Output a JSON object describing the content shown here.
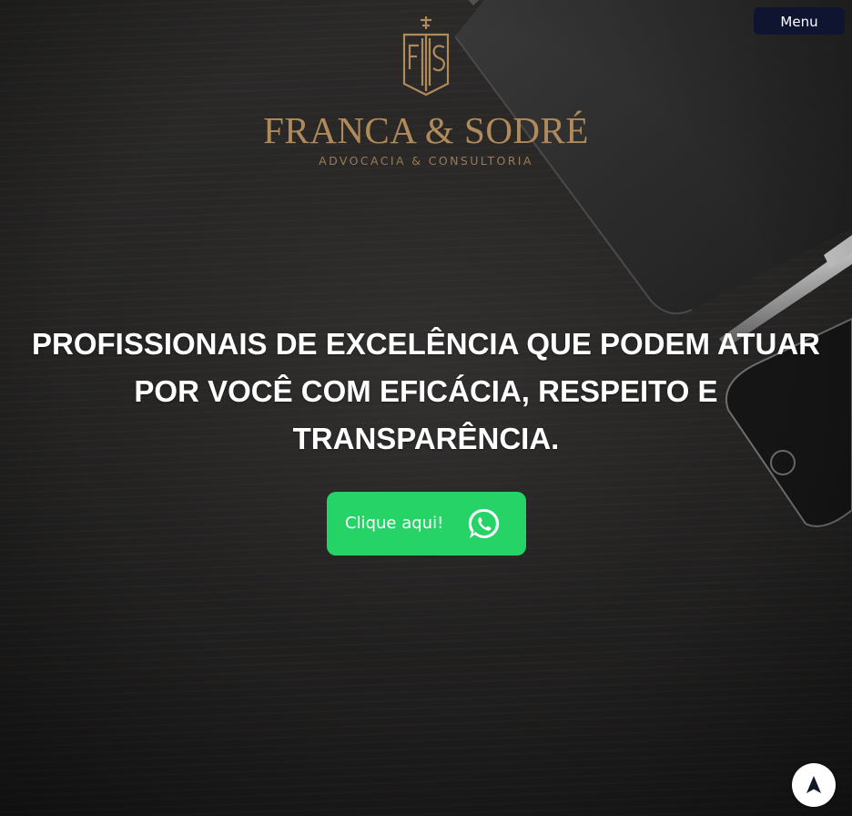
{
  "header": {
    "menu_label": "Menu"
  },
  "logo": {
    "monogram": "FS",
    "title": "FRANCA & SODRÉ",
    "subtitle": "ADVOCACIA & CONSULTORIA"
  },
  "hero": {
    "headline": "PROFISSIONAIS DE EXCELÊNCIA QUE PODEM ATUAR POR VOCÊ COM EFICÁCIA, RESPEITO E TRANSPARÊNCIA.",
    "cta_label": "Clique aqui!",
    "cta_icon": "whatsapp-icon"
  },
  "scroll_top": {
    "icon": "navigation-arrow-icon"
  },
  "colors": {
    "background": "#1c1b1b",
    "logo_gold": "#b08a5a",
    "menu_bg": "#0f1430",
    "cta_green": "#25d366",
    "text": "#ffffff"
  }
}
